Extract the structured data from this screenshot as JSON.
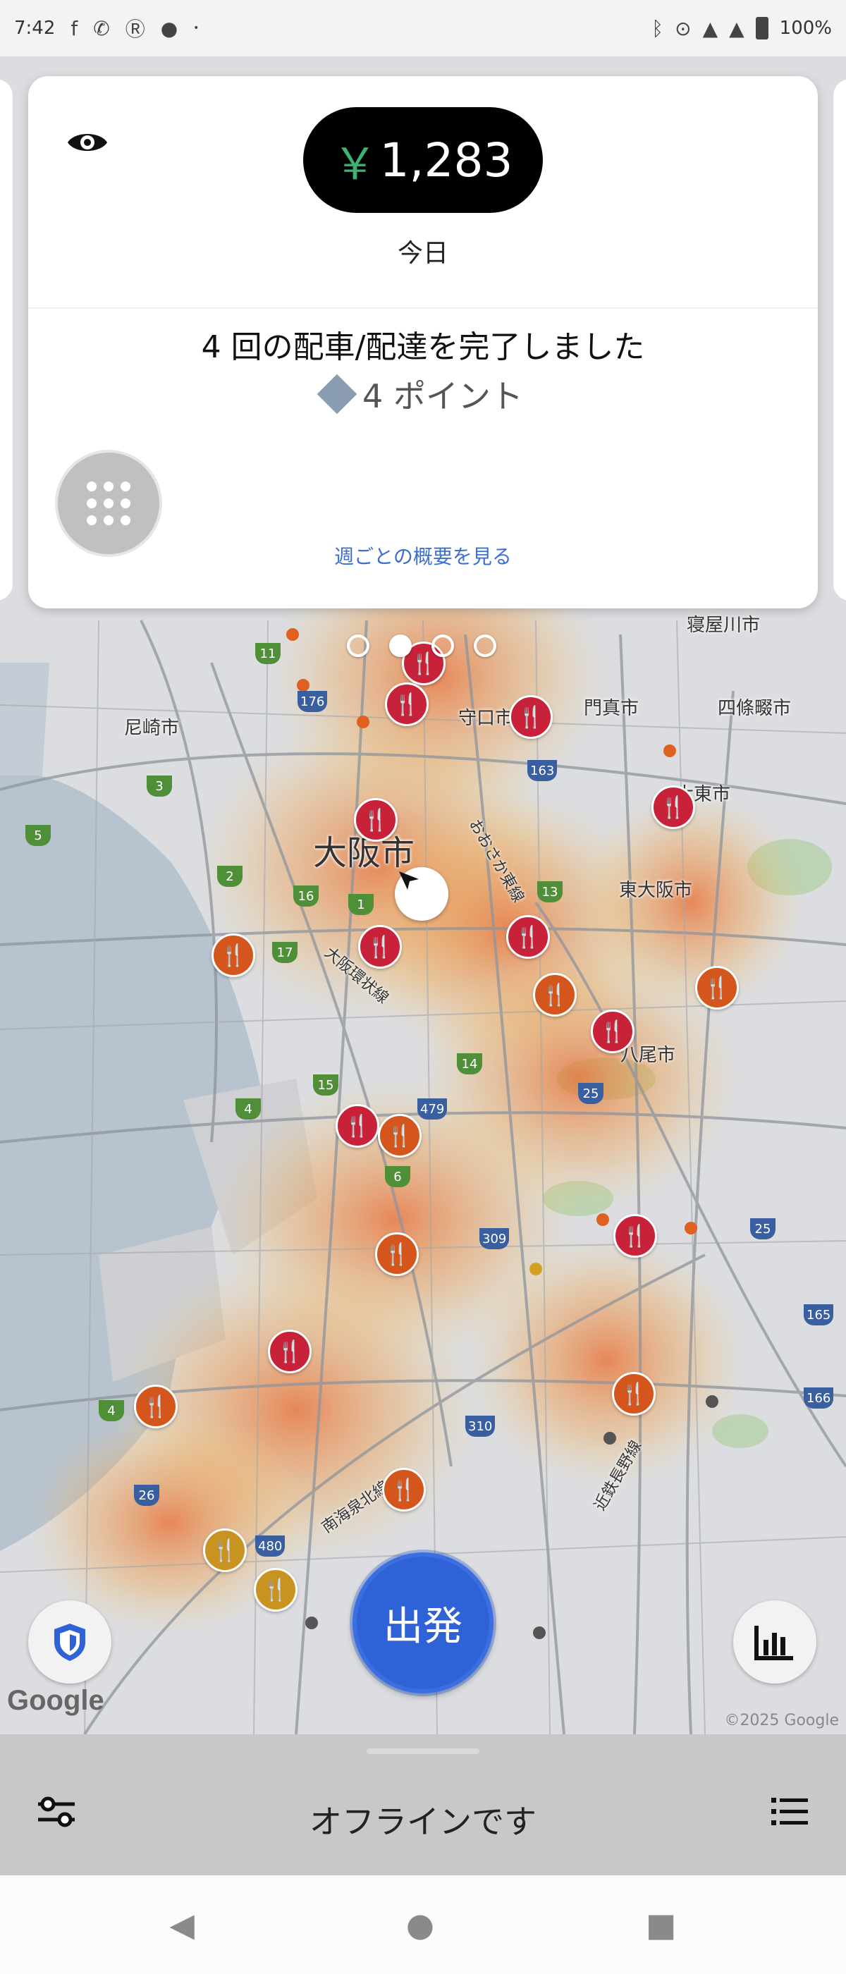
{
  "status_bar": {
    "time": "7:42",
    "battery": "100%",
    "left_icons": [
      "facebook-icon",
      "missed-call-icon",
      "rakuten-icon",
      "chat-icon",
      "dot-icon"
    ],
    "right_icons": [
      "bluetooth-icon",
      "location-icon",
      "signal-icon",
      "signal-icon",
      "battery-icon"
    ]
  },
  "earnings_card": {
    "currency": "￥",
    "amount": "1,283",
    "period": "今日",
    "trips_completed": "4 回の配車/配達を完了しました",
    "points": "4 ポイント",
    "weekly_link": "週ごとの概要を見る"
  },
  "pager": {
    "pages": 4,
    "active_index": 1
  },
  "map": {
    "labels": {
      "osaka": "大阪市",
      "amagasaki": "尼崎市",
      "moriguchi": "守口市",
      "kadoma": "門真市",
      "shijonawate": "四條畷市",
      "neyagawa": "寝屋川市",
      "daito": "大東市",
      "higashiosaka": "東大阪市",
      "yao": "八尾市",
      "expressway_north": "おおさか東線",
      "loop_line": "大阪環状線",
      "nankai": "南海泉北線",
      "kintetsu": "近鉄長野線",
      "ku": "ク",
      "city_partial": "市"
    },
    "attribution_logo": "Google",
    "copyright": "©2025 Google"
  },
  "go_button": {
    "label": "出発"
  },
  "bottom_bar": {
    "status": "オフラインです"
  },
  "colors": {
    "accent": "#2e62d6",
    "money_green": "#3bb371",
    "restaurant_red": "#c8223b",
    "restaurant_orange": "#d4561d",
    "points_diamond": "#8a9cb1"
  }
}
